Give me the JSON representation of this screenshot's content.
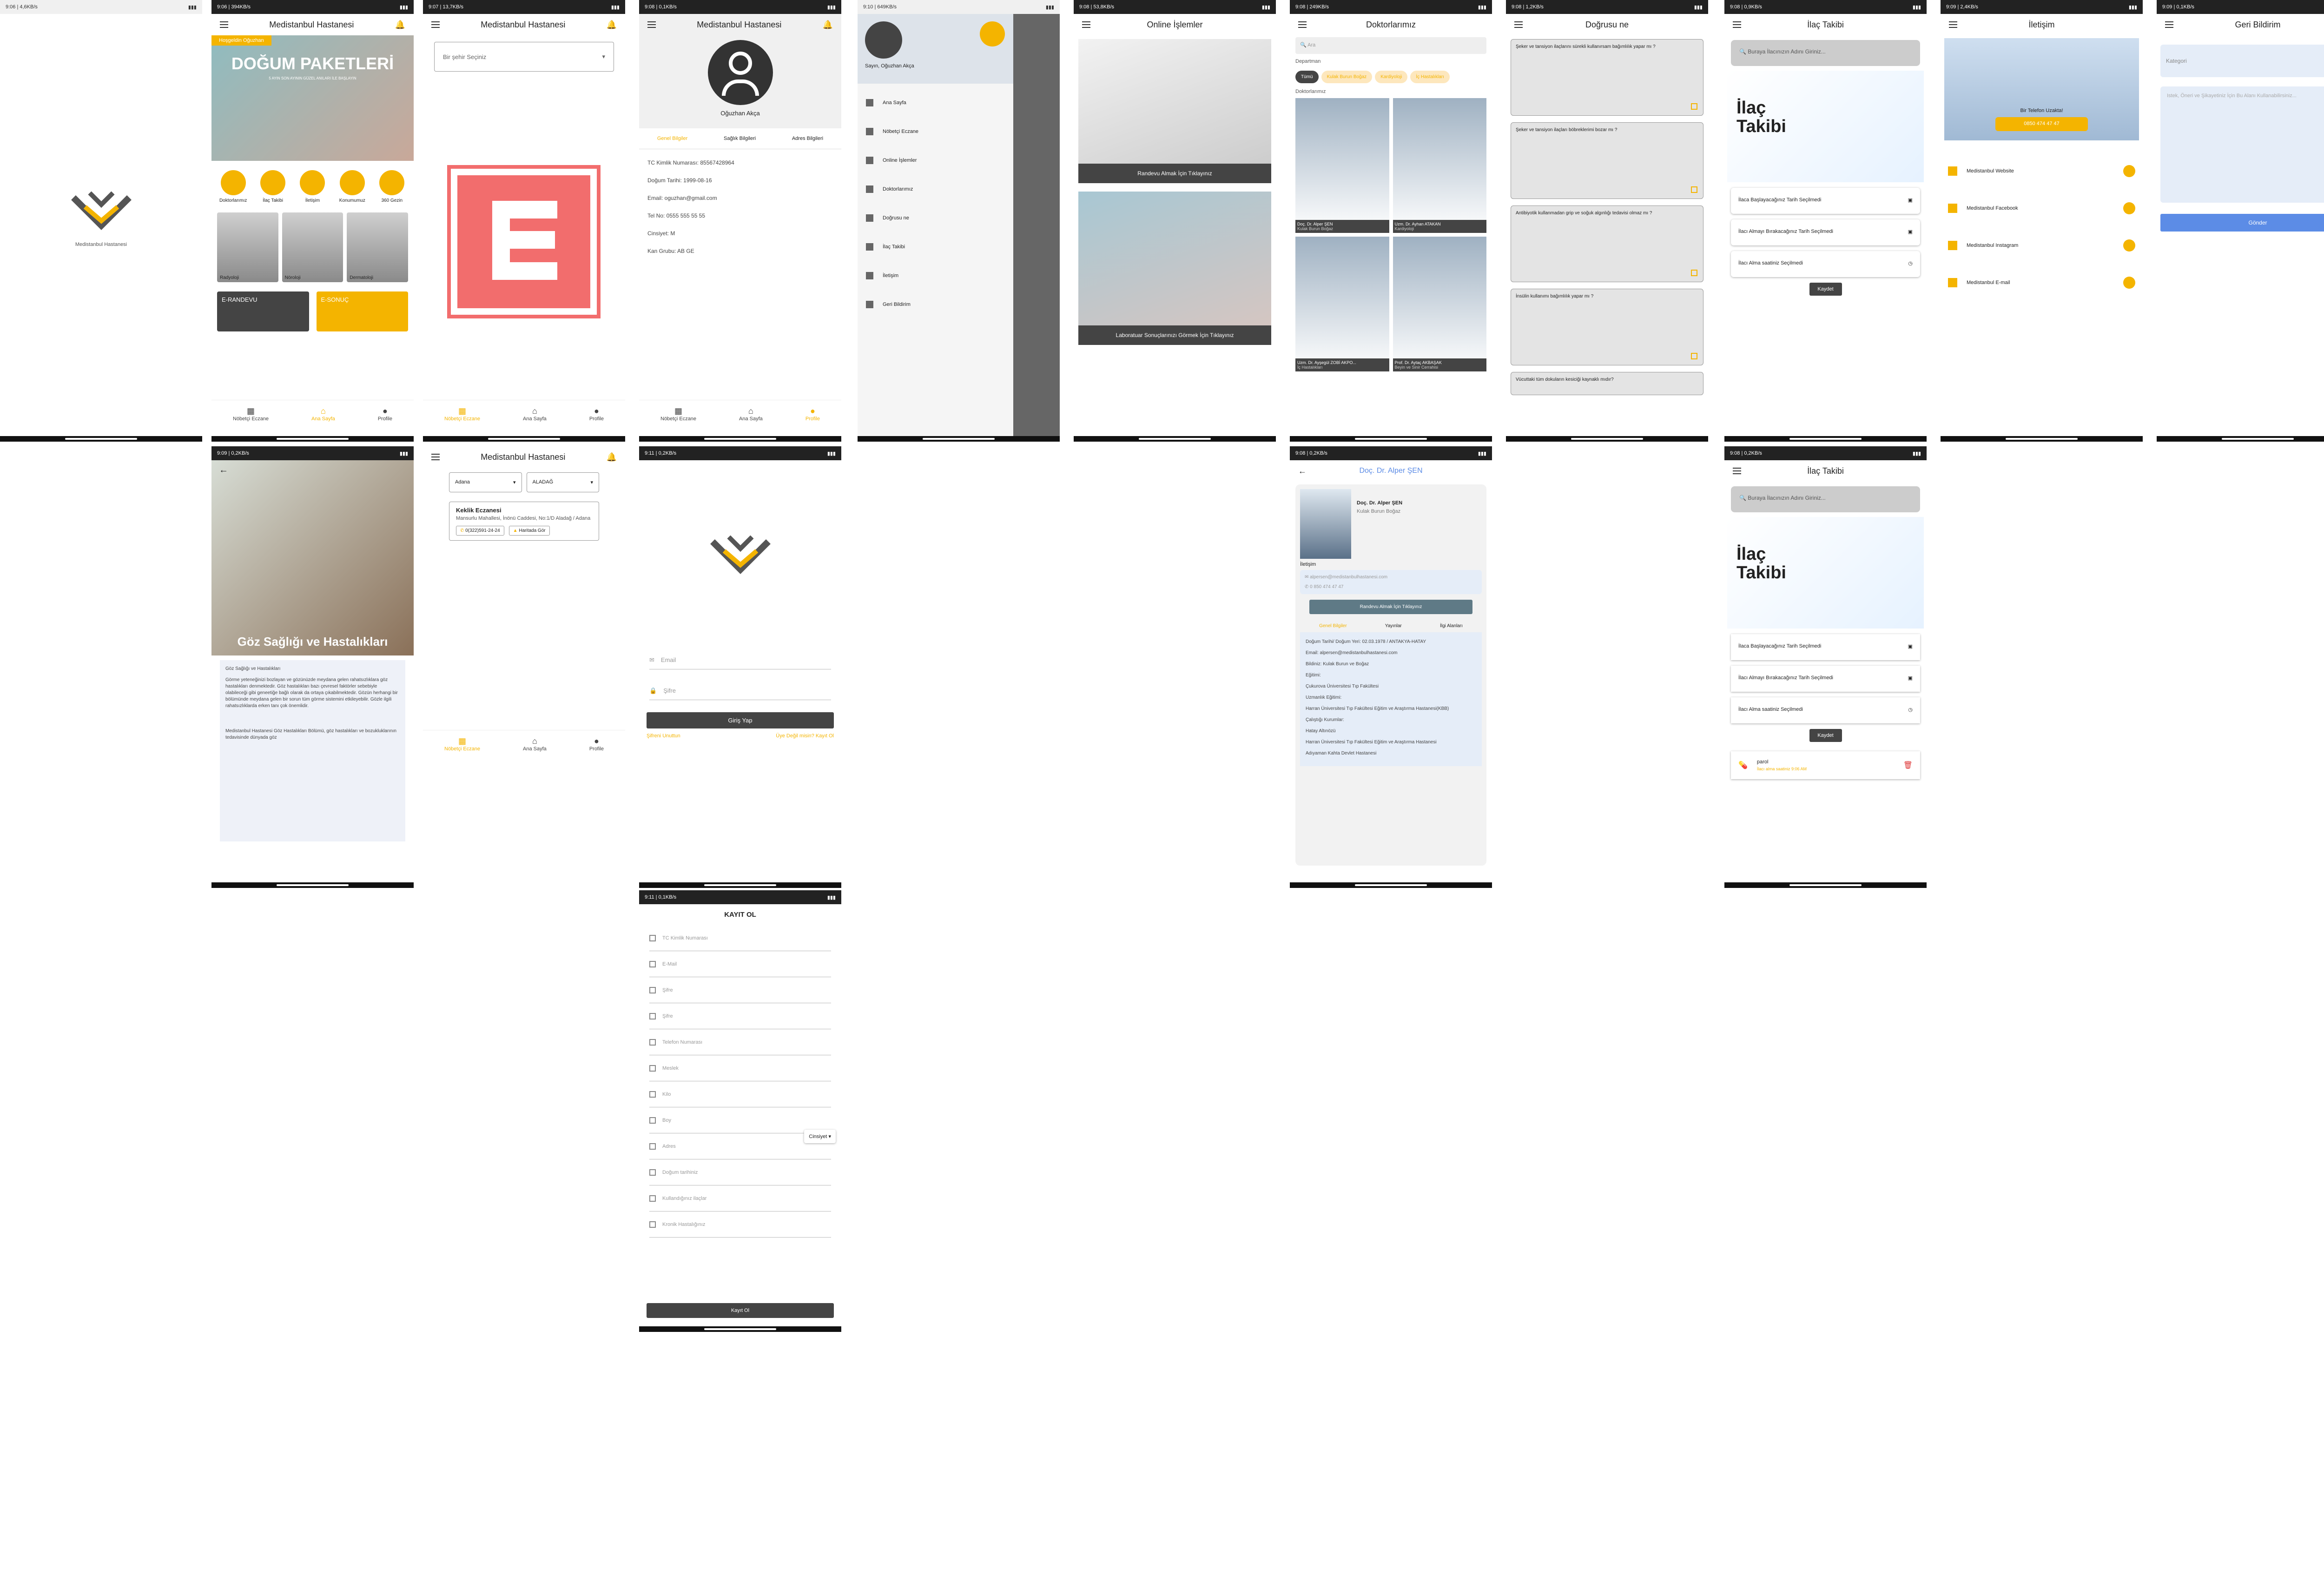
{
  "status": {
    "s1": "9:06 | 4,6KB/s",
    "s2": "9:06 | 394KB/s",
    "s3": "9:07 | 13,7KB/s",
    "s4": "9:08 | 0,1KB/s",
    "s5": "9:10 | 649KB/s",
    "s6": "9:08 | 53,8KB/s",
    "s7": "9:08 | 249KB/s",
    "s8": "9:08 | 1,2KB/s",
    "s9": "9:08 | 0,9KB/s",
    "s10": "9:09 | 2,4KB/s",
    "s11": "9:09 | 0,1KB/s",
    "s12": "9:09 | 0,2KB/s",
    "s14": "9:11 | 0,2KB/s",
    "s15": "9:08 | 0,2KB/s",
    "s16": "9:08 | 0,2KB/s",
    "s17": "9:11 | 0,1KB/s"
  },
  "app": {
    "name": "Medistanbul Hastanesi",
    "splash_caption": "Medistanbul Hastanesi"
  },
  "home": {
    "banner_tag": "Hoşgeldin Oğuzhan",
    "banner_title": "DOĞUM PAKETLERİ",
    "banner_sub": "5 AYIN SON AYININ GÜZEL ANILARI İLE BAŞLAYIN",
    "quick": [
      "Doktorlarımız",
      "İlaç Takibi",
      "İletişim",
      "Konumumuz",
      "360 Gezin"
    ],
    "depts": [
      "Radyoloji",
      "Nöroloji",
      "Dermatoloji"
    ],
    "erandevu": "E-RANDEVU",
    "esonuc": "E-SONUÇ"
  },
  "nav": {
    "nobetci": "Nöbetçi Eczane",
    "ana": "Ana Sayfa",
    "profile": "Profile"
  },
  "pharm": {
    "select": "Bir şehir Seçiniz",
    "city": "Adana",
    "district": "ALADAĞ",
    "name": "Keklik Eczanesi",
    "addr": "Mansurlu Mahallesi, İnönü Caddesi, No:1/D Aladağ / Adana",
    "phone": "0(322)591-24-24",
    "map": "Haritada Gör"
  },
  "profile": {
    "name": "Oğuzhan Akça",
    "tabs": [
      "Genel Bilgiler",
      "Sağlık Bilgileri",
      "Adres Bilgileri"
    ],
    "rows": [
      "TC Kimlik Numarası: 85567428964",
      "Doğum Tarihi: 1999-08-16",
      "Email: oguzhan@gmail.com",
      "Tel No: 0555 555 55 55",
      "Cinsiyet: M",
      "Kan Grubu: AB GE"
    ]
  },
  "drawer": {
    "user": "Sayın, Oğuzhan Akça",
    "items": [
      "Ana Sayfa",
      "Nöbetçi Eczane",
      "Online İşlemler",
      "Doktorlarımız",
      "Doğrusu ne",
      "İlaç Takibi",
      "İletişim",
      "Geri Bildirim"
    ]
  },
  "online": {
    "title": "Online İşlemler",
    "b1": "Randevu Almak İçin Tıklayınız",
    "b2": "Laboratuar Sonuçlarınızı Görmek İçin Tıklayınız"
  },
  "doctors": {
    "title": "Doktorlarımız",
    "search": "Ara",
    "dept_label": "Departman",
    "docs_label": "Doktorlarımız",
    "chips": [
      "Tümü",
      "Kulak Burun Boğaz",
      "Kardiyoloji",
      "İç Hastalıkları"
    ],
    "list": [
      {
        "n": "Doç. Dr. Alper ŞEN",
        "d": "Kulak Burun Boğaz"
      },
      {
        "n": "Uzm. Dr. Ayhan ATAKAN",
        "d": "Kardiyoloji"
      },
      {
        "n": "Uzm. Dr. Ayşegül ZOBİ AKPO...",
        "d": "İç Hastalıkları"
      },
      {
        "n": "Prof. Dr. Aytaç AKBAŞAK",
        "d": "Beyin ve Sinir Cerrahisi"
      }
    ]
  },
  "dogrusu": {
    "title": "Doğrusu ne",
    "q": [
      "Şeker ve tansiyon ilaçlarını sürekli kullanırsam bağımlılık yapar mı ?",
      "Şeker ve tansiyon ilaçları böbreklerimi bozar mı ?",
      "Antibiyotik kullanmadan grip ve soğuk algınlığı tedavisi olmaz mı ?",
      "İnsülin kullanımı bağımlılık yapar mı ?",
      "Vücuttaki tüm dokuların kesiciği kaynaklı mıdır?"
    ]
  },
  "ilac": {
    "title": "İlaç Takibi",
    "search": "Buraya İlacınızın Adını Giriniz...",
    "promo1": "İlaç",
    "promo2": "Takibi",
    "start": "İlaca Başlayacağınız Tarih Seçilmedi",
    "stop": "İlacı Almayı Bırakacağınız Tarih Seçilmedi",
    "time": "İlacı Alma saatiniz Seçilmedi",
    "save": "Kaydet",
    "drug": "parol",
    "drug_time": "İlacı alma saatiniz 9:06 AM"
  },
  "iletisim": {
    "title": "İletişim",
    "call": "Bir Telefon Uzakta!",
    "phone": "0850 474 47 47",
    "items": [
      "Medistanbul Website",
      "Medistanbul Facebook",
      "Medistanbul Instagram",
      "Medistanbul E-mail"
    ]
  },
  "geri": {
    "title": "Geri Bildirim",
    "cat": "Kategori",
    "ph": "Istek, Öneri ve Şikayetiniz İçin Bu Alanı Kullanabilirsiniz...",
    "send": "Gönder"
  },
  "eye": {
    "title": "Göz Sağlığı ve Hastalıkları",
    "h": "Göz Sağlığı ve Hastalıkları",
    "p1": "Görme yeteneğinizi bozlayan ve gözünüzde meydana gelen rahatsızlıklara göz hastalıkları denmektedir. Göz hastalıkları bazı çevresel faktörler sebebiyle olabileceği gibi geneetiğe bağlı olarak da ortaya çıkabilmektedir. Gözün herhangi bir bölümünde meydana gelen bir sorun tüm görme sistemini etkileyebilir. Gözle ilgili rahatsızlıklarda erken tanı çok önemlidir.",
    "p2": "Medistanbul Hastanesi Göz Hastalıkları Bölümü, göz hastalıkları ve bozukluklarının tedavisinde dünyada göz"
  },
  "login": {
    "email": "Email",
    "pass": "Şifre",
    "btn": "Giriş Yap",
    "reg": "Şifreni Unuttun",
    "reg2": "Üye Değil misin? Kayıt Ol"
  },
  "register": {
    "title": "KAYIT OL",
    "fields": [
      "TC Kimlik Numarası",
      "E-Mail",
      "Şifre",
      "Şifre",
      "Telefon Numarası",
      "Meslek",
      "Kilo",
      "Boy",
      "Adres",
      "Doğum tarihiniz",
      "Kullandığınız ilaçlar",
      "Kronik Hastalığınız"
    ],
    "gender": "Cinsiyet",
    "btn": "Kayıt Ol"
  },
  "docdetail": {
    "title": "Doç. Dr. Alper ŞEN",
    "name": "Doç. Dr. Alper ŞEN",
    "dept": "Kulak Burun Boğaz",
    "contact": "İletişim",
    "email": "alpersen@medistanbulhastanesi.com",
    "phone": "0 850 474 47 47",
    "btn": "Randevu Almak İçin Tıklayınız",
    "tabs": [
      "Genel Bilgiler",
      "Yayınlar",
      "İlgi Alanları"
    ],
    "lines": [
      "Doğum Tarihi/ Doğum Yeri: 02.03.1978 / ANTAKYA-HATAY",
      "Email: alpersen@medistanbulhastanesi.com",
      "Bildiniz: Kulak Burun ve Boğaz",
      "Eğitimi:",
      "Çukurova Üniversitesi Tıp Fakültesi",
      "Uzmanlık Eğitimi:",
      "Harran Üniversitesi Tıp Fakültesi Eğitim ve Araştırma Hastanesi(KBB)",
      "Çalıştığı Kurumlar:",
      "Hatay Altınözü",
      "Harran Üniversitesi Tıp Fakültesi Eğitim ve Araştırma Hastanesi",
      "Adıyaman Kahta Devlet Hastanesi"
    ]
  }
}
